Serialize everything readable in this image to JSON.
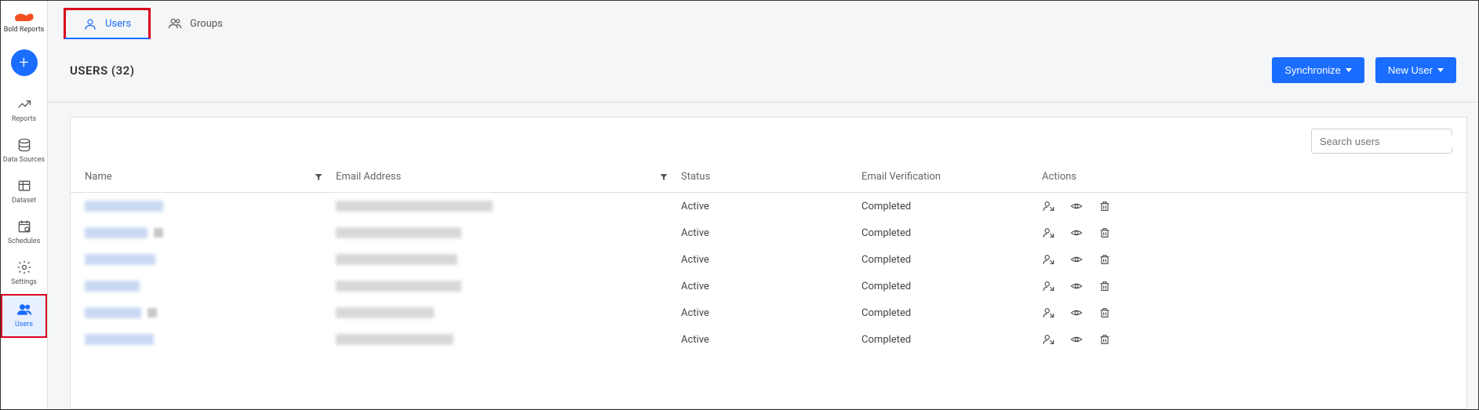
{
  "brand": {
    "name": "Bold Reports"
  },
  "sidebar": {
    "items": [
      {
        "label": "Reports"
      },
      {
        "label": "Data Sources"
      },
      {
        "label": "Dataset"
      },
      {
        "label": "Schedules"
      },
      {
        "label": "Settings"
      },
      {
        "label": "Users"
      }
    ]
  },
  "tabs": {
    "users": "Users",
    "groups": "Groups"
  },
  "page": {
    "title": "USERS (32)",
    "synchronize": "Synchronize",
    "newUser": "New User"
  },
  "search": {
    "placeholder": "Search users"
  },
  "table": {
    "headers": {
      "name": "Name",
      "email": "Email Address",
      "status": "Status",
      "verify": "Email Verification",
      "actions": "Actions"
    },
    "rows": [
      {
        "status": "Active",
        "verify": "Completed",
        "nw": 100,
        "gw": 0,
        "ew": 200
      },
      {
        "status": "Active",
        "verify": "Completed",
        "nw": 80,
        "gw": 16,
        "ew": 160
      },
      {
        "status": "Active",
        "verify": "Completed",
        "nw": 90,
        "gw": 0,
        "ew": 155
      },
      {
        "status": "Active",
        "verify": "Completed",
        "nw": 70,
        "gw": 0,
        "ew": 160
      },
      {
        "status": "Active",
        "verify": "Completed",
        "nw": 72,
        "gw": 12,
        "ew": 125
      },
      {
        "status": "Active",
        "verify": "Completed",
        "nw": 88,
        "gw": 0,
        "ew": 150
      }
    ]
  }
}
